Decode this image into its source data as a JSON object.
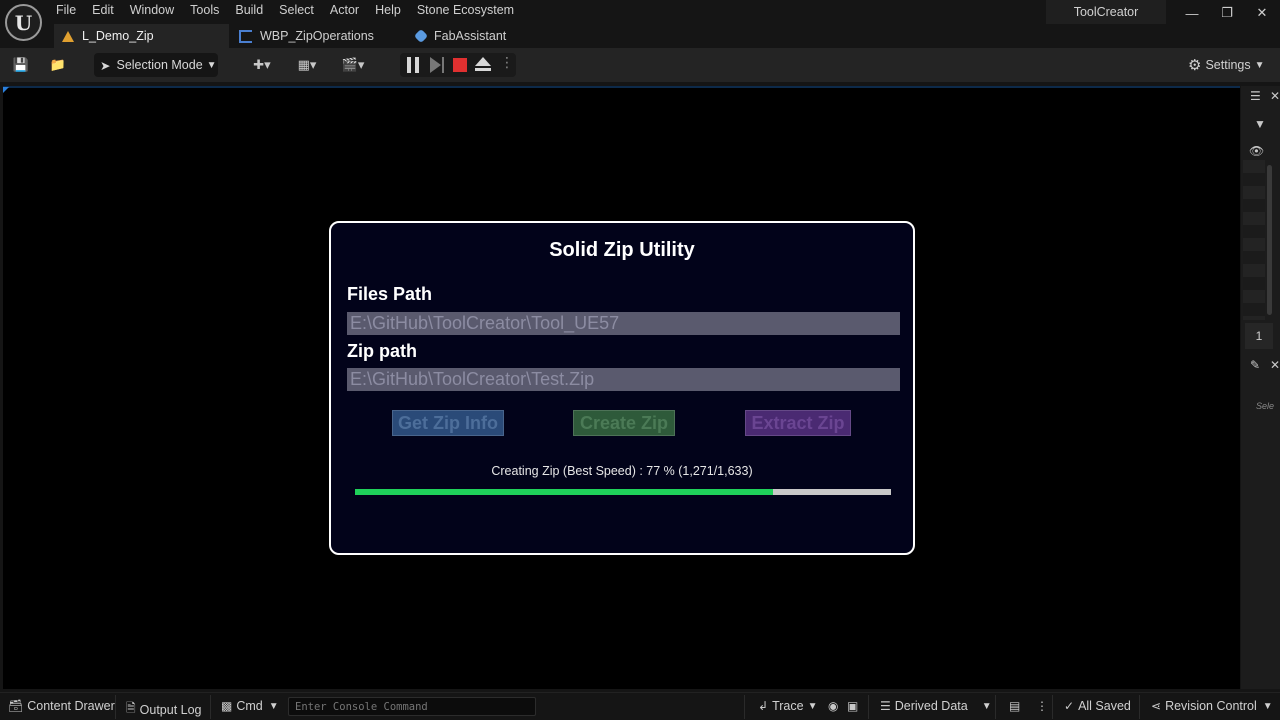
{
  "menu": [
    "File",
    "Edit",
    "Window",
    "Tools",
    "Build",
    "Select",
    "Actor",
    "Help",
    "Stone Ecosystem"
  ],
  "tabs": [
    {
      "label": "L_Demo_Zip",
      "icon": "level-icon"
    },
    {
      "label": "WBP_ZipOperations",
      "icon": "widget-blueprint-icon"
    },
    {
      "label": "FabAssistant",
      "icon": "fab-icon"
    }
  ],
  "project_name": "ToolCreator",
  "toolbar": {
    "mode_label": "Selection Mode",
    "settings_label": "Settings"
  },
  "widget": {
    "title": "Solid Zip Utility",
    "files_path_label": "Files Path",
    "files_path_value": "E:\\GitHub\\ToolCreator\\Tool_UE57",
    "zip_path_label": "Zip path",
    "zip_path_value": "E:\\GitHub\\ToolCreator\\Test.Zip",
    "buttons": {
      "get_info": "Get Zip Info",
      "create": "Create Zip",
      "extract": "Extract Zip"
    },
    "progress_text": "Creating Zip (Best Speed) : 77 % (1,271/1,633)",
    "progress_fraction": 0.78,
    "colors": {
      "progress_fill": "#1fd15a",
      "accent": "#2a7fdc",
      "stop": "#e03030"
    }
  },
  "right_panel": {
    "count": "1",
    "selection_hint": "Sele"
  },
  "statusbar": {
    "content_drawer": "Content Drawer",
    "output_log": "Output Log",
    "cmd": "Cmd",
    "console_placeholder": "Enter Console Command",
    "trace": "Trace",
    "derived_data": "Derived Data",
    "all_saved": "All Saved",
    "revision_control": "Revision Control"
  }
}
